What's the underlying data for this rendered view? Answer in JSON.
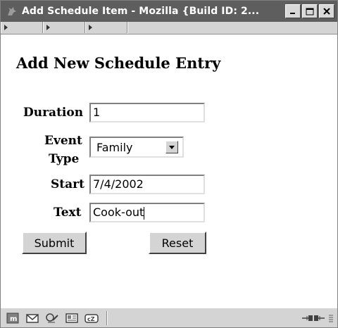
{
  "window": {
    "title": "Add Schedule Item - Mozilla {Build ID: 2...",
    "min_label": "_",
    "max_label": "□",
    "close_label": "✕"
  },
  "page": {
    "heading": "Add New Schedule Entry"
  },
  "form": {
    "duration_label": "Duration",
    "duration_value": "1",
    "event_type_label_1": "Event",
    "event_type_label_2": "Type",
    "event_type_value": "Family",
    "start_label": "Start",
    "start_value": "7/4/2002",
    "text_label": "Text",
    "text_value": "Cook-out",
    "submit_label": "Submit",
    "reset_label": "Reset"
  },
  "statusbar": {
    "icons": [
      "navigator-icon",
      "mail-icon",
      "composer-icon",
      "addressbook-icon",
      "irc-chat-icon"
    ],
    "online_icon": "connection-plug-icon"
  },
  "colors": {
    "titlebar": "#5e5e5e",
    "chrome": "#d4d4d4"
  }
}
